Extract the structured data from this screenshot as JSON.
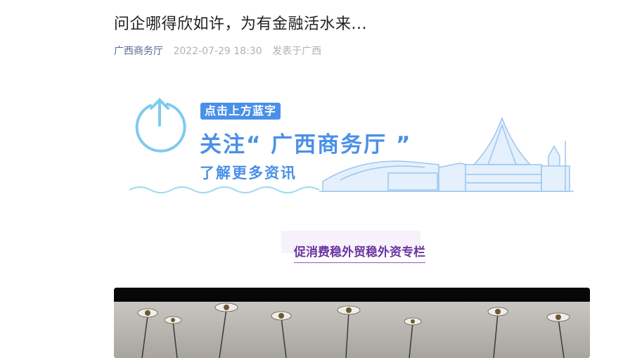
{
  "article": {
    "title": "问企哪得欣如许，为有金融活水来...",
    "account": "广西商务厅",
    "date": "2022-07-29 18:30",
    "location": "发表于广西"
  },
  "banner": {
    "tag": "点击上方蓝字",
    "follow_text": "关注“ 广西商务厅 ”",
    "learn_more": "了解更多资讯",
    "accent_color": "#4a90e8",
    "icon": "upload-arrow-icon"
  },
  "section": {
    "title": "促消费稳外贸稳外资专栏",
    "color": "#6a35a0"
  },
  "video": {
    "description_icon": "flower-field-video"
  }
}
